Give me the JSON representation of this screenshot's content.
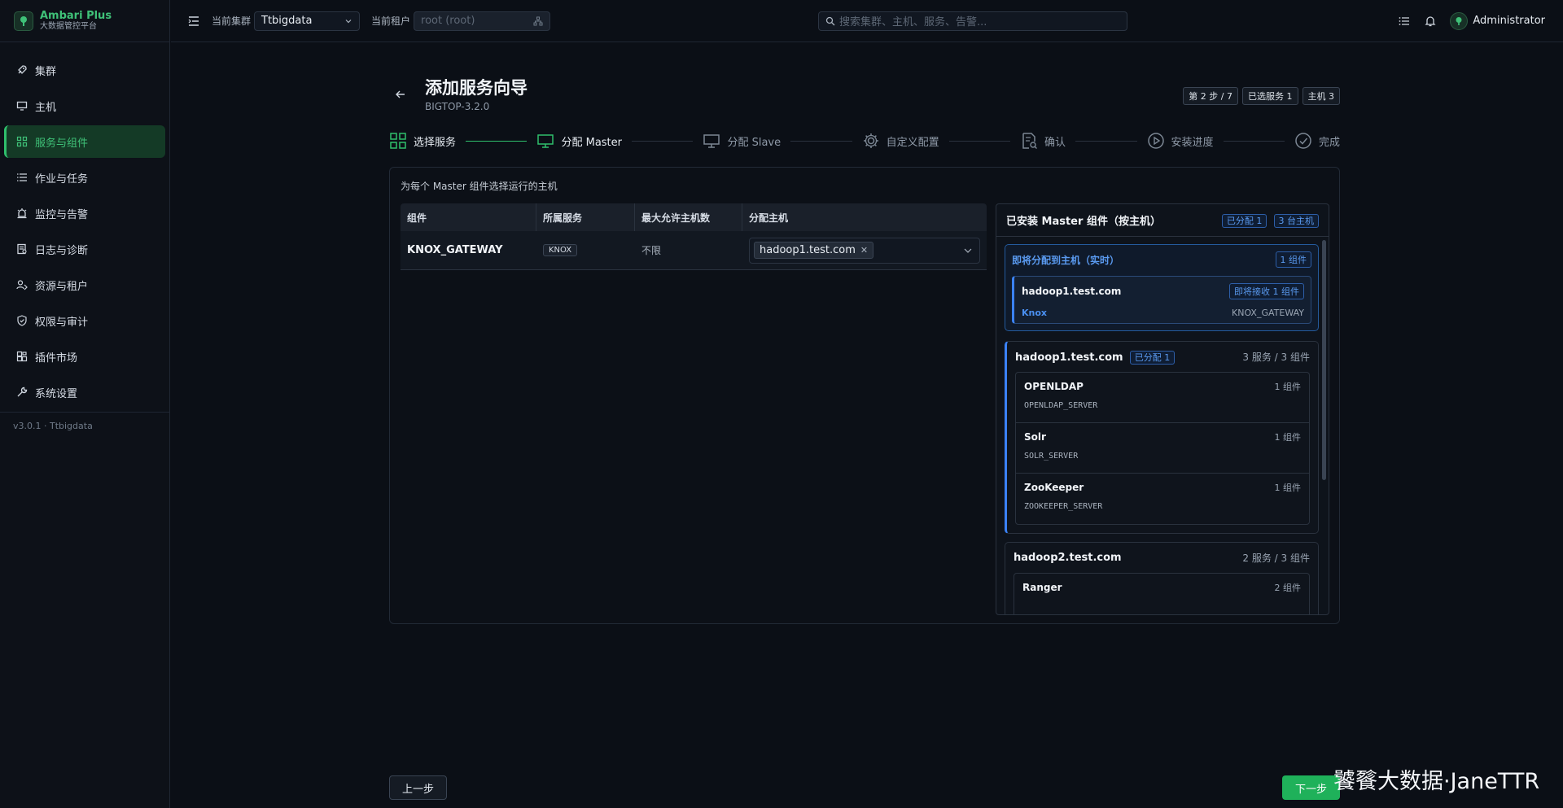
{
  "brand": {
    "name": "Ambari Plus",
    "subtitle": "大数据管控平台"
  },
  "sidebar": {
    "items": [
      {
        "label": "集群",
        "icon": "rocket-icon"
      },
      {
        "label": "主机",
        "icon": "monitor-icon"
      },
      {
        "label": "服务与组件",
        "icon": "grid-icon",
        "active": true
      },
      {
        "label": "作业与任务",
        "icon": "list-icon"
      },
      {
        "label": "监控与告警",
        "icon": "alarm-icon"
      },
      {
        "label": "日志与诊断",
        "icon": "log-icon"
      },
      {
        "label": "资源与租户",
        "icon": "users-icon"
      },
      {
        "label": "权限与审计",
        "icon": "shield-icon"
      },
      {
        "label": "插件市场",
        "icon": "puzzle-icon"
      },
      {
        "label": "系统设置",
        "icon": "wrench-icon"
      }
    ],
    "version": "v3.0.1 · Ttbigdata"
  },
  "topbar": {
    "cluster_label": "当前集群",
    "cluster_value": "Ttbigdata",
    "tenant_label": "当前租户",
    "tenant_placeholder": "root (root)",
    "search_placeholder": "搜索集群、主机、服务、告警...",
    "username": "Administrator"
  },
  "header": {
    "title": "添加服务向导",
    "subtitle": "BIGTOP-3.2.0",
    "badges": [
      "第 2 步 / 7",
      "已选服务 1",
      "主机 3"
    ]
  },
  "steps": [
    {
      "label": "选择服务",
      "state": "done"
    },
    {
      "label": "分配 Master",
      "state": "current"
    },
    {
      "label": "分配 Slave",
      "state": "todo"
    },
    {
      "label": "自定义配置",
      "state": "todo"
    },
    {
      "label": "确认",
      "state": "todo"
    },
    {
      "label": "安装进度",
      "state": "todo"
    },
    {
      "label": "完成",
      "state": "todo"
    }
  ],
  "colors": {
    "accent": "#2fbf6c",
    "info": "#3b82f6"
  },
  "panel": {
    "description": "为每个 Master 组件选择运行的主机",
    "table": {
      "headers": [
        "组件",
        "所属服务",
        "最大允许主机数",
        "分配主机"
      ],
      "rows": [
        {
          "component": "KNOX_GATEWAY",
          "service": "KNOX",
          "max_hosts": "不限",
          "hosts": [
            "hadoop1.test.com"
          ]
        }
      ]
    }
  },
  "installed": {
    "title": "已安装 Master 组件（按主机）",
    "tag_assigned": "已分配 1",
    "tag_hosts": "3 台主机",
    "pending": {
      "title": "即将分配到主机（实时）",
      "count": "1 组件",
      "host": "hadoop1.test.com",
      "receive": "即将接收 1 组件",
      "service": "Knox",
      "component": "KNOX_GATEWAY"
    },
    "hosts": [
      {
        "name": "hadoop1.test.com",
        "tag": "已分配 1",
        "summary": "3 服务 / 3 组件",
        "components": [
          {
            "service": "OPENLDAP",
            "count": "1 组件",
            "code": "OPENLDAP_SERVER"
          },
          {
            "service": "Solr",
            "count": "1 组件",
            "code": "SOLR_SERVER"
          },
          {
            "service": "ZooKeeper",
            "count": "1 组件",
            "code": "ZOOKEEPER_SERVER"
          }
        ]
      },
      {
        "name": "hadoop2.test.com",
        "summary": "2 服务 / 3 组件",
        "components": [
          {
            "service": "Ranger",
            "count": "2 组件"
          }
        ]
      }
    ]
  },
  "footer": {
    "prev": "上一步",
    "next": "下一步"
  },
  "watermark": "饕餮大数据·JaneTTR"
}
